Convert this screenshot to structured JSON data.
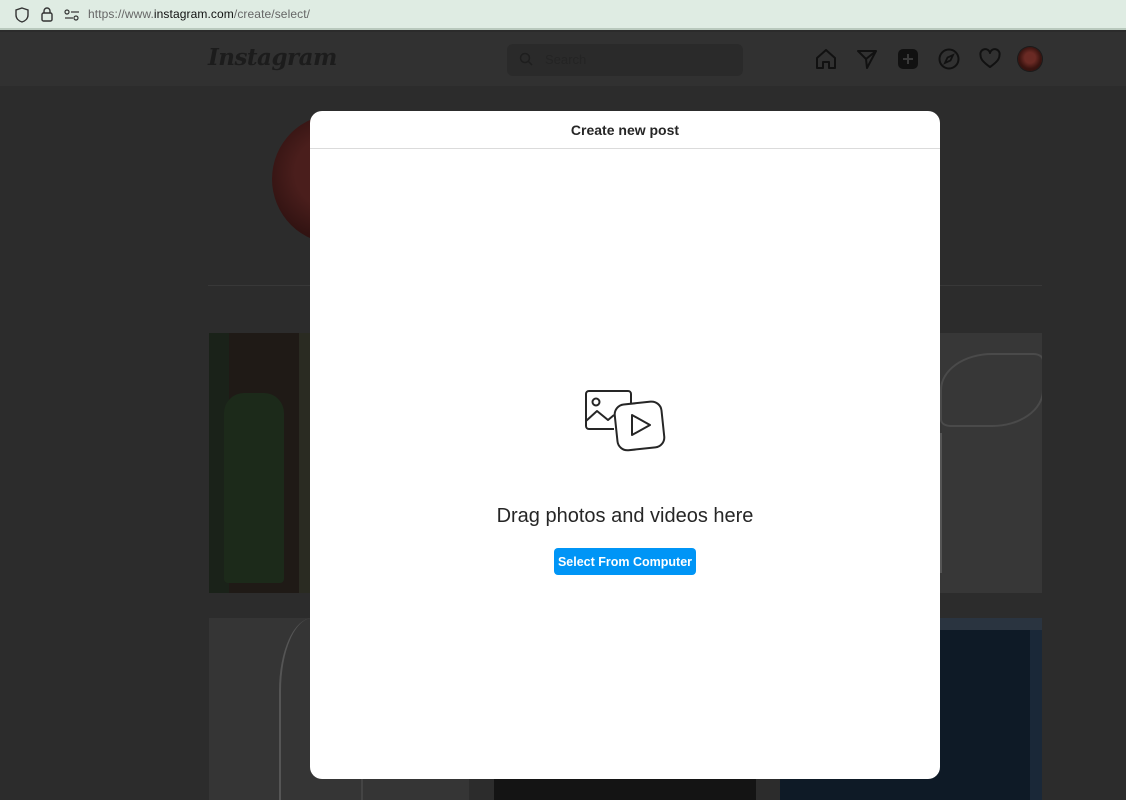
{
  "browser": {
    "url_prefix": "https://www.",
    "url_host": "instagram.com",
    "url_path": "/create/select/"
  },
  "header": {
    "logo": "Instagram",
    "search_placeholder": "Search",
    "nav_icons": [
      "home-icon",
      "direct-message-icon",
      "new-post-icon",
      "explore-icon",
      "activity-heart-icon"
    ]
  },
  "modal": {
    "title": "Create new post",
    "drag_text": "Drag photos and videos here",
    "select_button": "Select From Computer"
  }
}
